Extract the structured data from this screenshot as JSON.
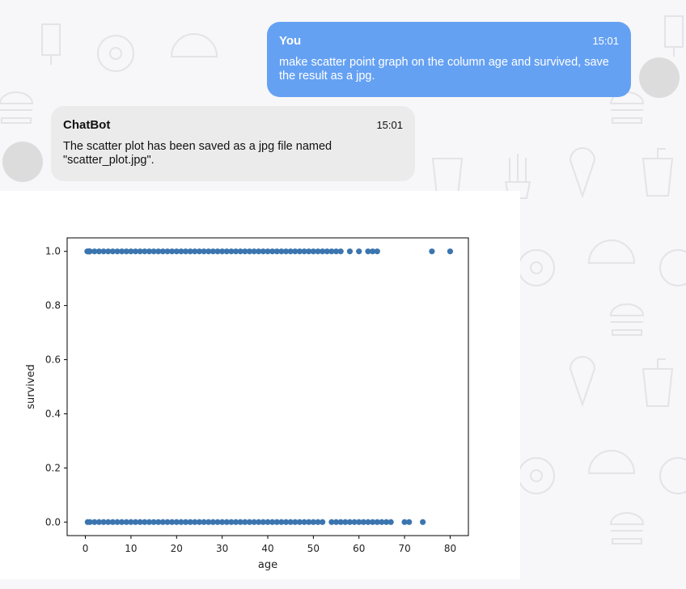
{
  "messages": [
    {
      "sender": "You",
      "time": "15:01",
      "text": "make scatter point graph on the column age and survived, save the result as a jpg."
    },
    {
      "sender": "ChatBot",
      "time": "15:01",
      "text": "The scatter plot has been saved as a jpg file named \"scatter_plot.jpg\"."
    }
  ],
  "colors": {
    "user_bubble": "#65a1f3",
    "bot_bubble": "#ebebeb",
    "point": "#3b75af"
  },
  "chart_data": {
    "type": "scatter",
    "xlabel": "age",
    "ylabel": "survived",
    "xlim": [
      -4,
      84
    ],
    "ylim": [
      -0.05,
      1.05
    ],
    "xticks": [
      0,
      10,
      20,
      30,
      40,
      50,
      60,
      70,
      80
    ],
    "yticks": [
      0.0,
      0.2,
      0.4,
      0.6,
      0.8,
      1.0
    ],
    "xtick_labels": [
      "0",
      "10",
      "20",
      "30",
      "40",
      "50",
      "60",
      "70",
      "80"
    ],
    "ytick_labels": [
      "0.0",
      "0.2",
      "0.4",
      "0.6",
      "0.8",
      "1.0"
    ],
    "series": [
      {
        "y": 1,
        "x": [
          0.42,
          0.67,
          0.75,
          0.83,
          0.92,
          1,
          2,
          3,
          4,
          5,
          6,
          7,
          8,
          9,
          10,
          11,
          12,
          13,
          14,
          15,
          16,
          17,
          18,
          19,
          20,
          21,
          22,
          23,
          24,
          25,
          26,
          27,
          28,
          29,
          30,
          31,
          32,
          33,
          34,
          35,
          36,
          37,
          38,
          39,
          40,
          41,
          42,
          43,
          44,
          45,
          46,
          47,
          48,
          49,
          50,
          51,
          52,
          53,
          54,
          55,
          56,
          58,
          60,
          62,
          63,
          64,
          76,
          80
        ]
      },
      {
        "y": 0,
        "x": [
          0.5,
          1,
          2,
          3,
          4,
          5,
          6,
          7,
          8,
          9,
          10,
          11,
          12,
          13,
          14,
          15,
          16,
          17,
          18,
          19,
          20,
          21,
          22,
          23,
          24,
          25,
          26,
          27,
          28,
          29,
          30,
          31,
          32,
          33,
          34,
          35,
          36,
          37,
          38,
          39,
          40,
          41,
          42,
          43,
          44,
          45,
          46,
          47,
          48,
          49,
          50,
          51,
          52,
          54,
          55,
          56,
          57,
          58,
          59,
          60,
          61,
          62,
          63,
          64,
          65,
          66,
          67,
          70,
          71,
          74
        ]
      }
    ]
  }
}
